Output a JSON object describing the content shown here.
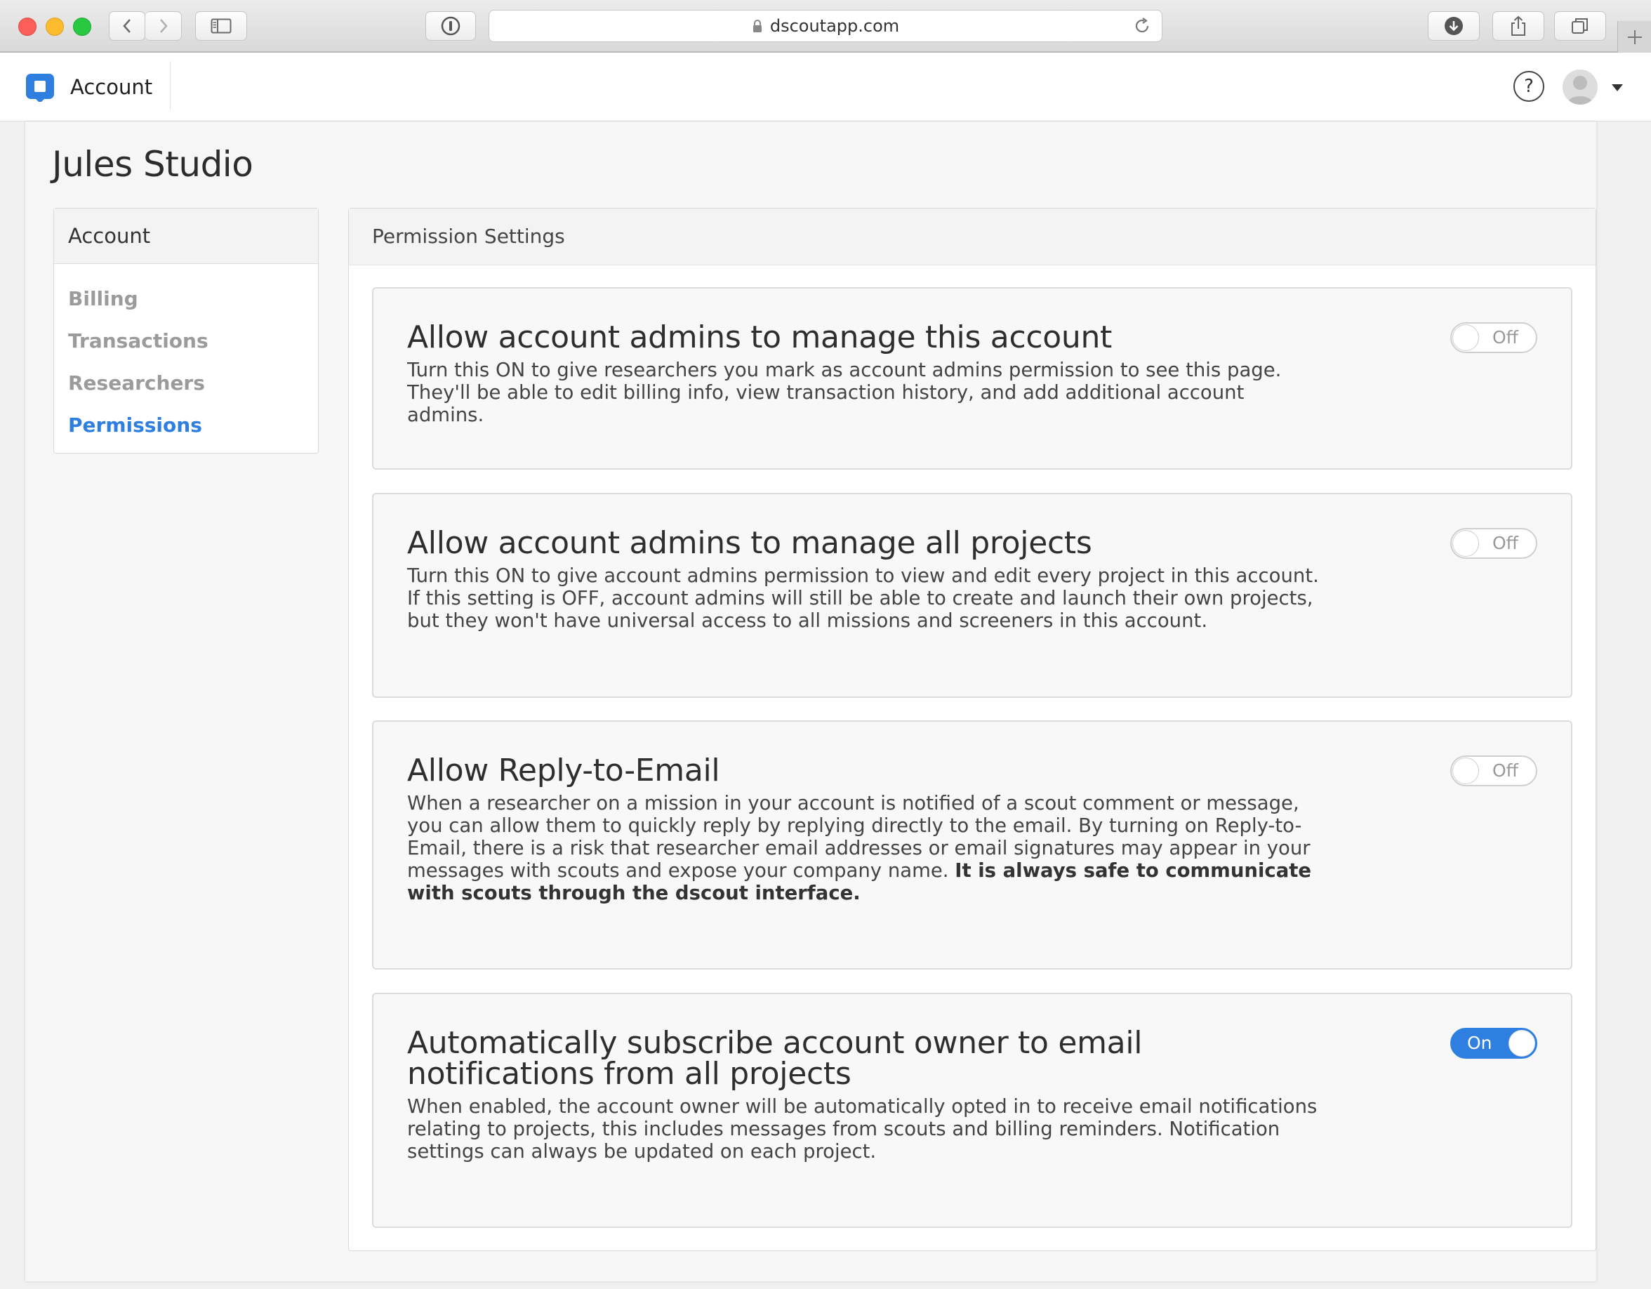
{
  "browser": {
    "url": "dscoutapp.com"
  },
  "app": {
    "title": "Account",
    "help_label": "?",
    "accent_color": "#2f7fe0"
  },
  "page": {
    "title": "Jules Studio"
  },
  "sidebar": {
    "header": "Account",
    "items": [
      {
        "label": "Billing",
        "active": false
      },
      {
        "label": "Transactions",
        "active": false
      },
      {
        "label": "Researchers",
        "active": false
      },
      {
        "label": "Permissions",
        "active": true
      }
    ]
  },
  "panel": {
    "title": "Permission Settings",
    "settings": [
      {
        "title": "Allow account admins to manage this account",
        "description": "Turn this ON to give researchers you mark as account admins permission to see this page. They'll be able to edit billing info, view transaction history, and add additional account admins.",
        "toggle_label": "Off",
        "enabled": false
      },
      {
        "title": "Allow account admins to manage all projects",
        "description": "Turn this ON to give account admins permission to view and edit every project in this account. If this setting is OFF, account admins will still be able to create and launch their own projects, but they won't have universal access to all missions and screeners in this account.",
        "toggle_label": "Off",
        "enabled": false
      },
      {
        "title": "Allow Reply-to-Email",
        "description": "When a researcher on a mission in your account is notified of a scout comment or message, you can allow them to quickly reply by replying directly to the email. By turning on Reply-to-Email, there is a risk that researcher email addresses or email signatures may appear in your messages with scouts and expose your company name.",
        "description_bold": "It is always safe to communicate with scouts through the dscout interface.",
        "toggle_label": "Off",
        "enabled": false
      },
      {
        "title": "Automatically subscribe account owner to email notifications from all projects",
        "description": "When enabled, the account owner will be automatically opted in to receive email notifications relating to projects, this includes messages from scouts and billing reminders. Notification settings can always be updated on each project.",
        "toggle_label": "On",
        "enabled": true
      }
    ]
  }
}
